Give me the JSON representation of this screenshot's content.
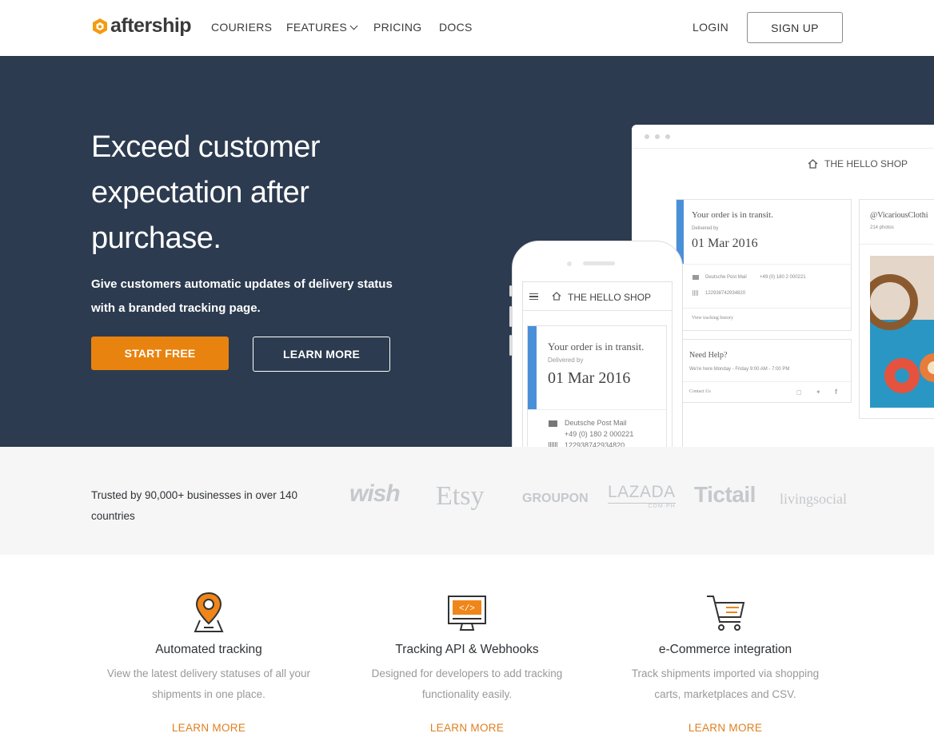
{
  "nav": {
    "logo_text": "aftership",
    "links": [
      "COURIERS",
      "FEATURES",
      "PRICING",
      "DOCS"
    ],
    "login": "LOGIN",
    "signup": "SIGN UP"
  },
  "hero": {
    "title": "Exceed customer expectation after purchase.",
    "subtitle": "Give customers automatic updates of delivery status with a branded tracking page.",
    "start_button": "START FREE",
    "learn_button": "LEARN MORE"
  },
  "mock": {
    "shop_name": "THE HELLO SHOP",
    "status": "Your order is in transit.",
    "delivered_by": "Delivered by",
    "date": "01 Mar 2016",
    "courier": "Deutsche Post Mail",
    "phone": "+49 (0) 180 2 000221",
    "tracking_number": "122938742934820",
    "view_history": "View tracking history",
    "need_help": "Need Help?",
    "hours": "We're here Monday - Friday  9:00 AM - 7:00 PM",
    "contact": "Contact Us",
    "instagram_handle": "@VicariousClothi",
    "photos": "214 photos"
  },
  "trust": {
    "text": "Trusted by 90,000+ businesses in over 140 countries",
    "brands": [
      "wish",
      "Etsy",
      "GROUPON",
      "LAZADA",
      "Tictail",
      "livingsocial"
    ],
    "lazada_sub": "COM·PH"
  },
  "features": [
    {
      "title": "Automated tracking",
      "desc": "View the latest delivery statuses of all your shipments in one place.",
      "link": "LEARN MORE",
      "icon": "map-pin-icon"
    },
    {
      "title": "Tracking API & Webhooks",
      "desc": "Designed for developers to add tracking functionality easily.",
      "link": "LEARN MORE",
      "icon": "code-monitor-icon"
    },
    {
      "title": "e-Commerce integration",
      "desc": "Track shipments imported via shopping carts, marketplaces and CSV.",
      "link": "LEARN MORE",
      "icon": "shopping-cart-icon"
    }
  ],
  "colors": {
    "accent": "#e8830f",
    "hero_bg": "#2c3b4f",
    "trust_bg": "#f6f6f6",
    "link": "#e07f1e"
  }
}
